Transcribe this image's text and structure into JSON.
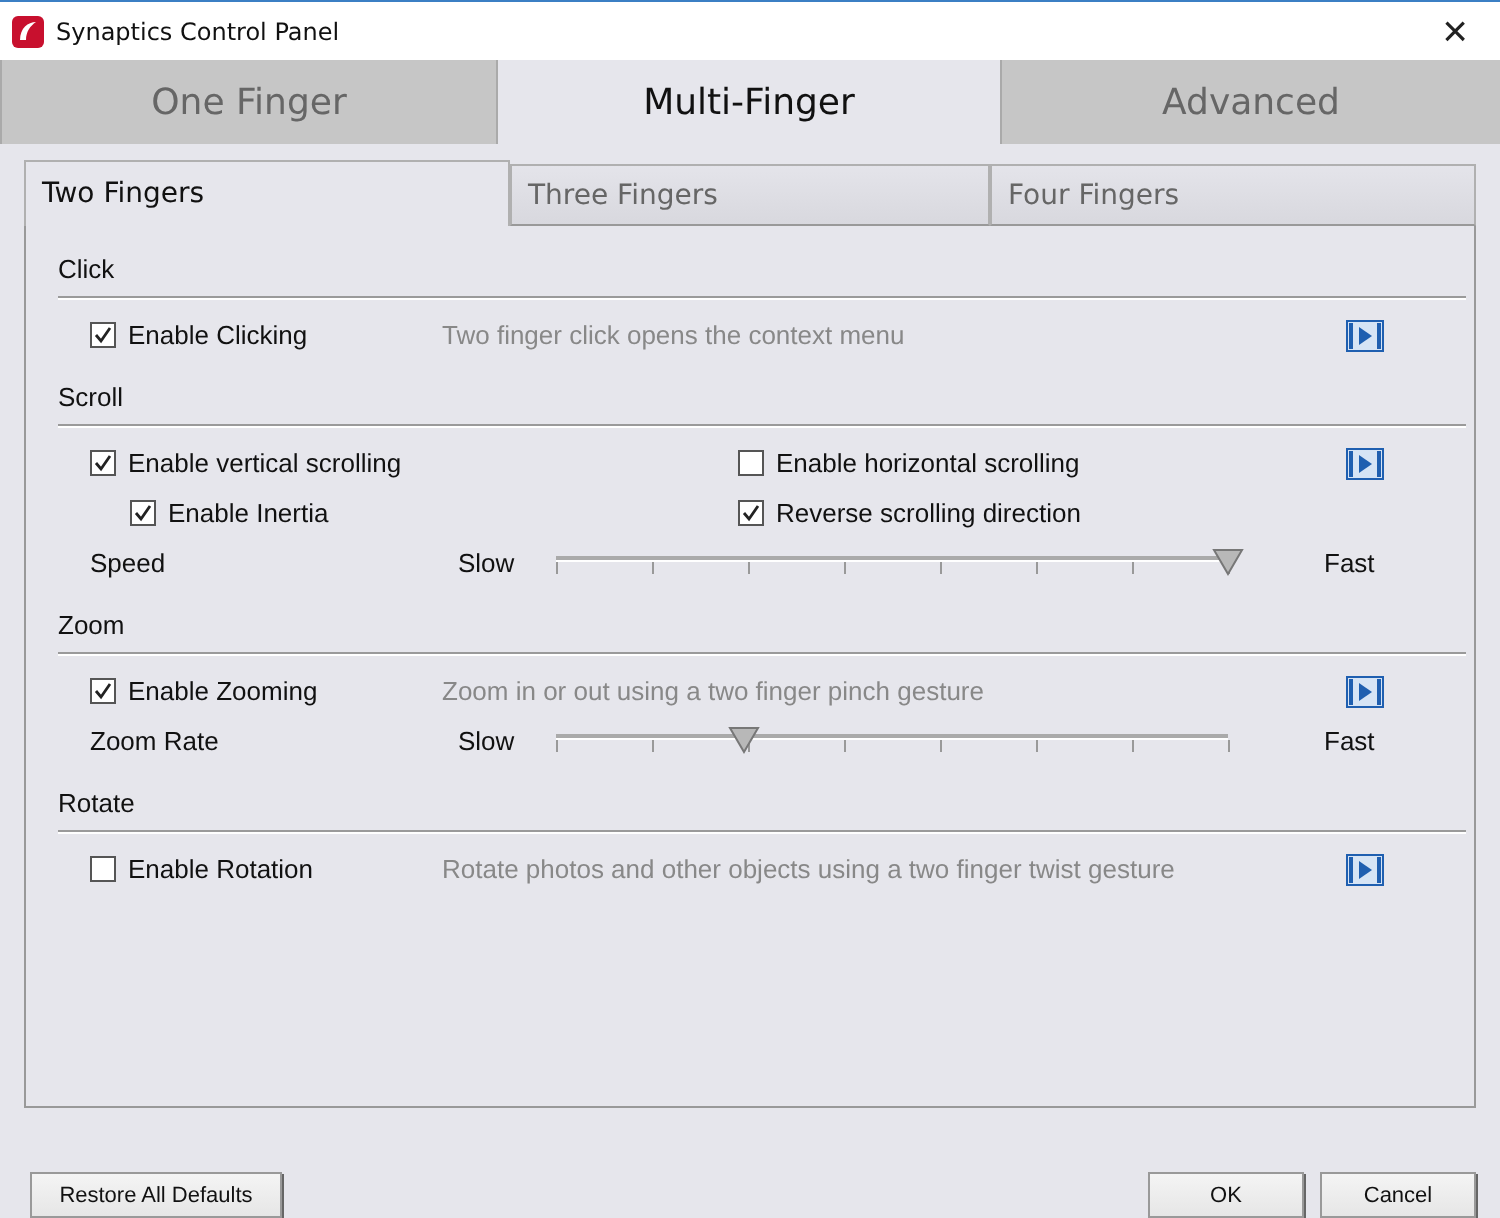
{
  "window": {
    "title": "Synaptics Control Panel",
    "close": "×"
  },
  "main_tabs": [
    {
      "label": "One Finger",
      "selected": false
    },
    {
      "label": "Multi-Finger",
      "selected": true
    },
    {
      "label": "Advanced",
      "selected": false
    }
  ],
  "sub_tabs": [
    {
      "label": "Two Fingers",
      "selected": true
    },
    {
      "label": "Three Fingers",
      "selected": false
    },
    {
      "label": "Four Fingers",
      "selected": false
    }
  ],
  "sections": [
    {
      "title": "Click",
      "rows": [
        {
          "kind": "option",
          "label": "Enable Clicking",
          "checked": true,
          "description": "Two finger click opens the context menu",
          "video": true
        }
      ]
    },
    {
      "title": "Scroll",
      "rows": [
        {
          "kind": "pair",
          "left": {
            "label": "Enable vertical scrolling",
            "checked": true,
            "nested": false
          },
          "right": {
            "label": "Enable horizontal scrolling",
            "checked": false
          },
          "video": true
        },
        {
          "kind": "pair",
          "left": {
            "label": "Enable Inertia",
            "checked": true,
            "nested": true
          },
          "right": {
            "label": "Reverse scrolling direction",
            "checked": true
          },
          "video": false
        },
        {
          "kind": "slider",
          "label": "Speed",
          "min_label": "Slow",
          "max_label": "Fast",
          "level": 1.0
        }
      ]
    },
    {
      "title": "Zoom",
      "rows": [
        {
          "kind": "option",
          "label": "Enable Zooming",
          "checked": true,
          "description": "Zoom in or out using a two finger pinch gesture",
          "video": true
        },
        {
          "kind": "slider",
          "label": "Zoom Rate",
          "min_label": "Slow",
          "max_label": "Fast",
          "level": 0.28
        }
      ]
    },
    {
      "title": "Rotate",
      "rows": [
        {
          "kind": "option",
          "label": "Enable Rotation",
          "checked": false,
          "description": "Rotate photos and other objects using a two finger twist gesture",
          "video": true
        }
      ]
    }
  ],
  "buttons": {
    "restore": "Restore All Defaults",
    "ok": "OK",
    "cancel": "Cancel"
  }
}
